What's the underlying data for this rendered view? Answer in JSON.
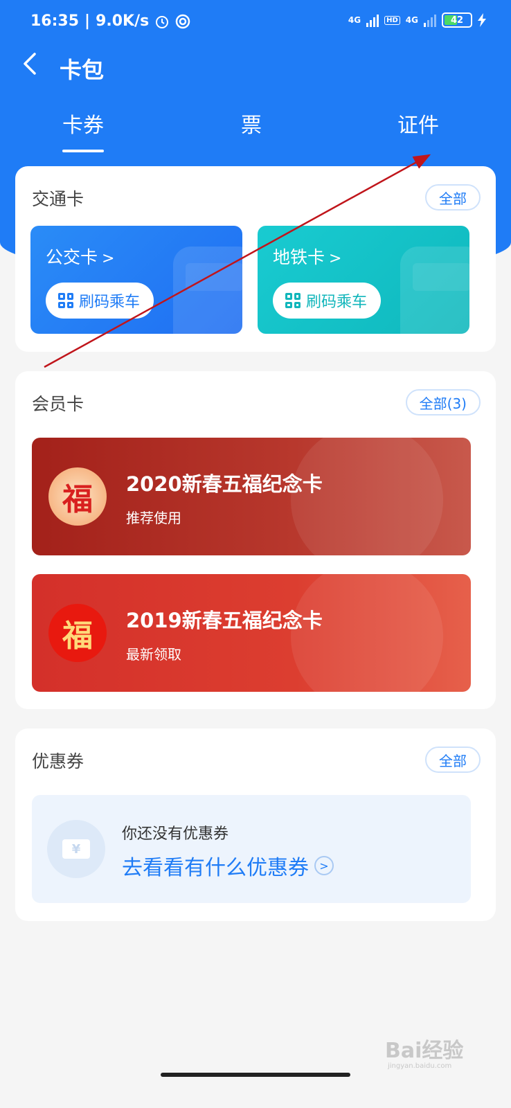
{
  "status_bar": {
    "time": "16:35",
    "speed": "9.0K/s",
    "net1": "4G",
    "hd": "HD",
    "net2": "4G",
    "battery": "42"
  },
  "header": {
    "back_icon": "chevron-left-icon",
    "title": "卡包"
  },
  "tabs": [
    {
      "label": "卡券",
      "active": true
    },
    {
      "label": "票",
      "active": false
    },
    {
      "label": "证件",
      "active": false
    }
  ],
  "transit": {
    "title": "交通卡",
    "all_label": "全部",
    "cards": [
      {
        "name": "公交卡",
        "button": "刷码乘车",
        "color": "#1f7cf6"
      },
      {
        "name": "地铁卡",
        "button": "刷码乘车",
        "color": "#11c3c7"
      }
    ]
  },
  "membership": {
    "title": "会员卡",
    "all_label": "全部(3)",
    "cards": [
      {
        "title": "2020新春五福纪念卡",
        "subtitle": "推荐使用",
        "icon_text": "福",
        "color": "#b32a21"
      },
      {
        "title": "2019新春五福纪念卡",
        "subtitle": "最新领取",
        "icon_text": "福",
        "color": "#d8372a"
      }
    ]
  },
  "coupons": {
    "title": "优惠券",
    "all_label": "全部",
    "empty_text": "你还没有优惠券",
    "link_text": "去看看有什么优惠券",
    "icon_text": "¥"
  },
  "watermark": {
    "brand": "Bai经验",
    "url": "jingyan.baidu.com"
  },
  "colors": {
    "primary": "#1f7cf6",
    "annotation_arrow": "#c0151b"
  }
}
